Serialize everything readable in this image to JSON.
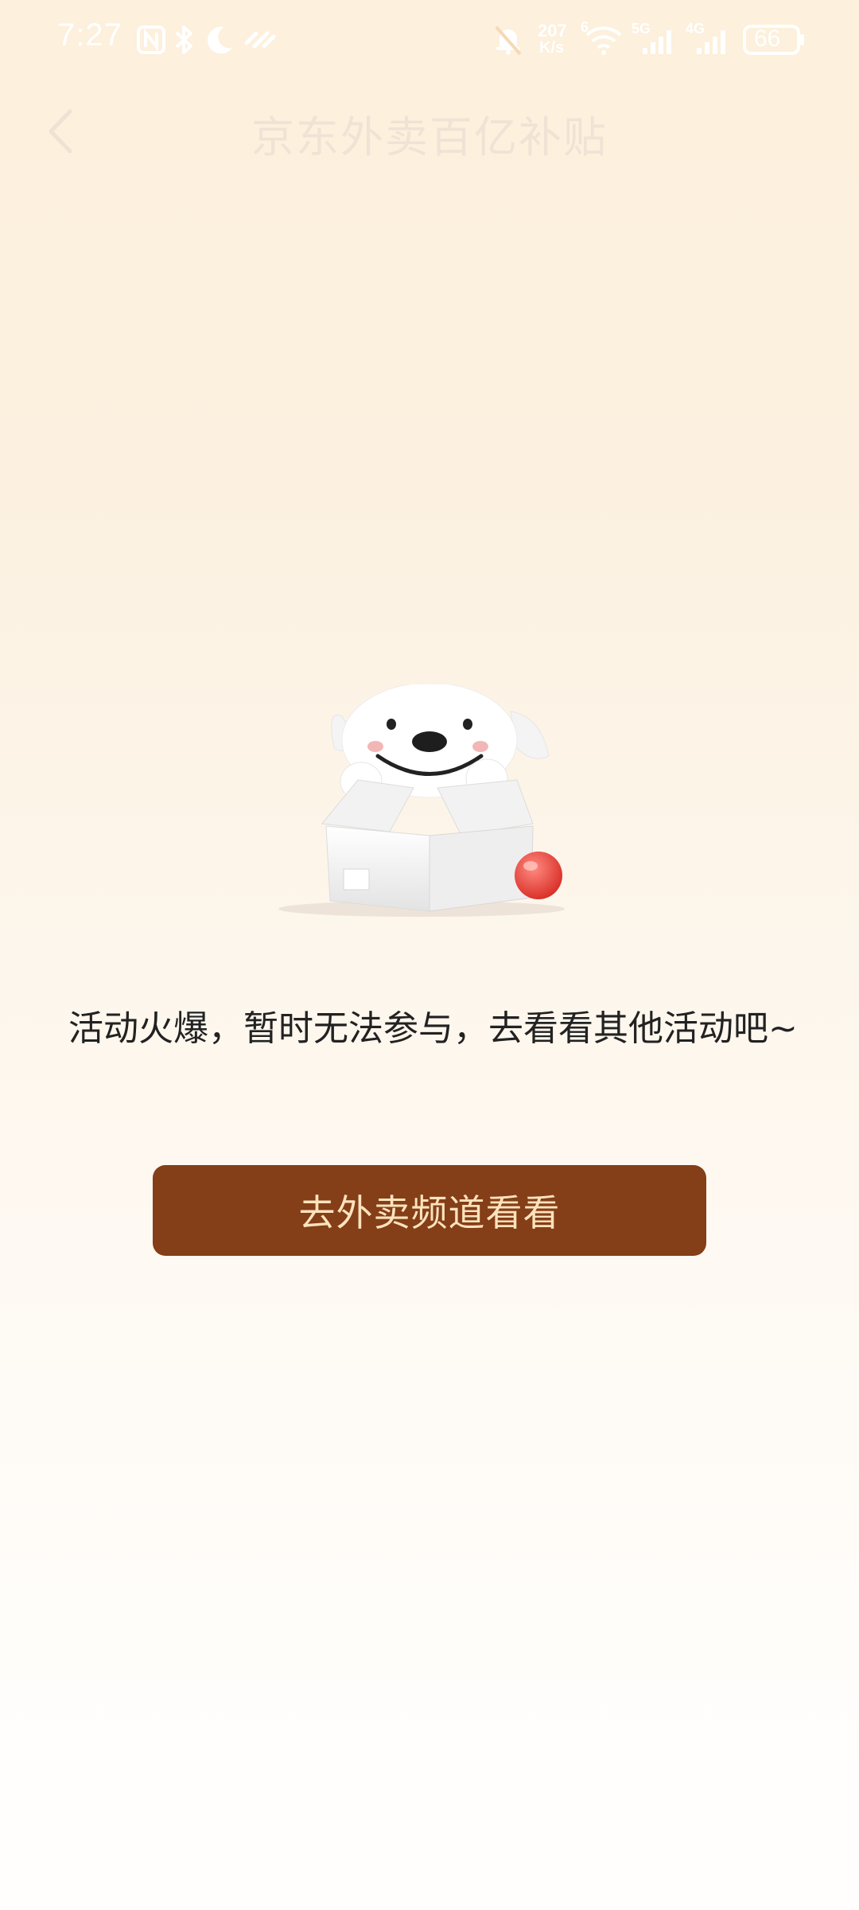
{
  "status_bar": {
    "time": "7:27",
    "network_speed_value": "207",
    "network_speed_unit": "K/s",
    "wifi_badge": "6",
    "cell1_label": "5G",
    "cell2_label": "4G",
    "battery": "66"
  },
  "nav": {
    "title": "京东外卖百亿补贴"
  },
  "content": {
    "message": "活动火爆，暂时无法参与，去看看其他活动吧~",
    "button_label": "去外卖频道看看"
  },
  "colors": {
    "button_bg": "#843e18",
    "button_text": "#fbe3bd",
    "background_top": "#fdf0dc",
    "background_bottom": "#fffefd"
  },
  "icons": {
    "status": [
      "nfc-icon",
      "bluetooth-icon",
      "moon-icon",
      "sync-icon",
      "bell-off-icon",
      "wifi-icon",
      "signal-icon",
      "battery-icon"
    ],
    "nav": [
      "back-arrow-icon"
    ]
  }
}
